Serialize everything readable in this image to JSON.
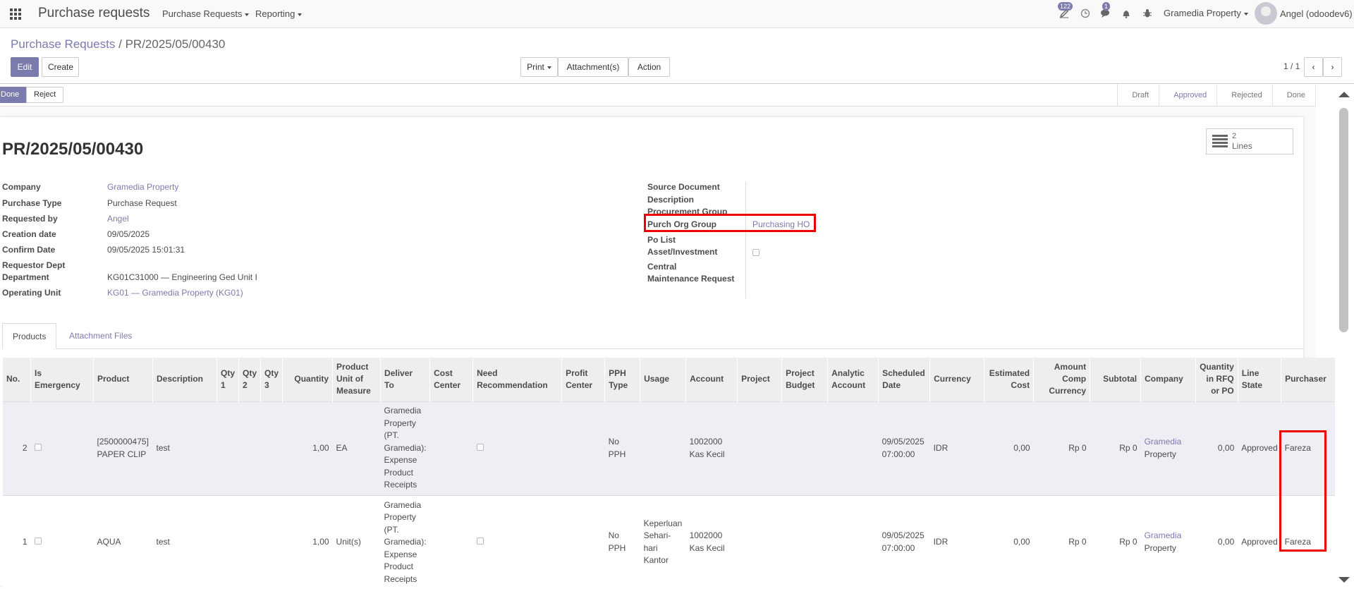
{
  "navbar": {
    "brand": "Purchase requests",
    "menu_purchase": "Purchase Requests",
    "menu_reporting": "Reporting",
    "activity_badge": "122",
    "messages_badge": "1",
    "company": "Gramedia Property",
    "user": "Angel (odoodev6)"
  },
  "breadcrumb": {
    "parent": "Purchase Requests",
    "separator": "/",
    "current": "PR/2025/05/00430"
  },
  "controls": {
    "edit": "Edit",
    "create": "Create",
    "print": "Print",
    "attachments": "Attachment(s)",
    "action": "Action",
    "pager": "1 / 1"
  },
  "statusbar": {
    "done": "Done",
    "reject": "Reject",
    "stages": [
      "Draft",
      "Approved",
      "Rejected",
      "Done"
    ],
    "active_stage": "Approved"
  },
  "smart_button": {
    "count": "2",
    "label": "Lines"
  },
  "form": {
    "title": "PR/2025/05/00430",
    "left": {
      "company_label": "Company",
      "company": "Gramedia Property",
      "purchase_type_label": "Purchase Type",
      "purchase_type": "Purchase Request",
      "requested_by_label": "Requested by",
      "requested_by": "Angel",
      "creation_date_label": "Creation date",
      "creation_date": "09/05/2025",
      "confirm_date_label": "Confirm Date",
      "confirm_date": "09/05/2025 15:01:31",
      "requestor_dept_label": "Requestor Dept",
      "department_label": "Department",
      "department": "KG01C31000 — Engineering Ged Unit I",
      "operating_unit_label": "Operating Unit",
      "operating_unit": "KG01 — Gramedia Property (KG01)"
    },
    "right": {
      "source_document_label": "Source Document",
      "description_label": "Description",
      "procurement_group_label": "Procurement Group",
      "purch_org_group_label": "Purch Org Group",
      "purch_org_group": "Purchasing HO",
      "po_list_label": "Po List",
      "asset_investment_label": "Asset/Investment",
      "central_label": "Central",
      "maintenance_request_label": "Maintenance Request"
    }
  },
  "tabs": [
    "Products",
    "Attachment Files"
  ],
  "table": {
    "headers": [
      [
        "No."
      ],
      [
        "Is",
        "Emergency"
      ],
      [
        "Product"
      ],
      [
        "Description"
      ],
      [
        "Qty",
        "1"
      ],
      [
        "Qty",
        "2"
      ],
      [
        "Qty",
        "3"
      ],
      [
        "Quantity"
      ],
      [
        "Product",
        "Unit of",
        "Measure"
      ],
      [
        "Deliver",
        "To"
      ],
      [
        "Cost",
        "Center"
      ],
      [
        "Need",
        "Recommendation"
      ],
      [
        "Profit",
        "Center"
      ],
      [
        "PPH",
        "Type"
      ],
      [
        "Usage"
      ],
      [
        "Account"
      ],
      [
        "Project"
      ],
      [
        "Project",
        "Budget"
      ],
      [
        "Analytic",
        "Account"
      ],
      [
        "Scheduled",
        "Date"
      ],
      [
        "Currency"
      ],
      [
        "Estimated",
        "Cost"
      ],
      [
        "Amount",
        "Comp",
        "Currency"
      ],
      [
        "Subtotal"
      ],
      [
        "Company"
      ],
      [
        "Quantity",
        "in RFQ",
        "or PO"
      ],
      [
        "Line",
        "State"
      ],
      [
        "Purchaser"
      ]
    ],
    "rows": [
      {
        "no": "2",
        "product": [
          "[2500000475]",
          "PAPER CLIP"
        ],
        "description": "test",
        "quantity": "1,00",
        "uom": "EA",
        "deliver_to": [
          "Gramedia",
          "Property",
          "(PT.",
          "Gramedia):",
          "Expense",
          "Product",
          "Receipts"
        ],
        "pph": [
          "No",
          "PPH"
        ],
        "usage": [],
        "account": [
          "1002000",
          "Kas Kecil"
        ],
        "scheduled": [
          "09/05/2025",
          "07:00:00"
        ],
        "currency": "IDR",
        "estimated_cost": "0,00",
        "amount_comp": "Rp 0",
        "subtotal": "Rp 0",
        "company": [
          "Gramedia",
          "Property"
        ],
        "qty_rfq": "0,00",
        "line_state": "Approved",
        "purchaser": "Fareza"
      },
      {
        "no": "1",
        "product": [
          "AQUA"
        ],
        "description": "test",
        "quantity": "1,00",
        "uom": "Unit(s)",
        "deliver_to": [
          "Gramedia",
          "Property",
          "(PT.",
          "Gramedia):",
          "Expense",
          "Product",
          "Receipts"
        ],
        "pph": [
          "No",
          "PPH"
        ],
        "usage": [
          "Keperluan",
          "Sehari-",
          "hari",
          "Kantor"
        ],
        "account": [
          "1002000",
          "Kas Kecil"
        ],
        "scheduled": [
          "09/05/2025",
          "07:00:00"
        ],
        "currency": "IDR",
        "estimated_cost": "0,00",
        "amount_comp": "Rp 0",
        "subtotal": "Rp 0",
        "company": [
          "Gramedia",
          "Property"
        ],
        "qty_rfq": "0,00",
        "line_state": "Approved",
        "purchaser": "Fareza"
      }
    ]
  },
  "colors": {
    "accent": "#7c7bad",
    "highlight": "#e00000"
  }
}
